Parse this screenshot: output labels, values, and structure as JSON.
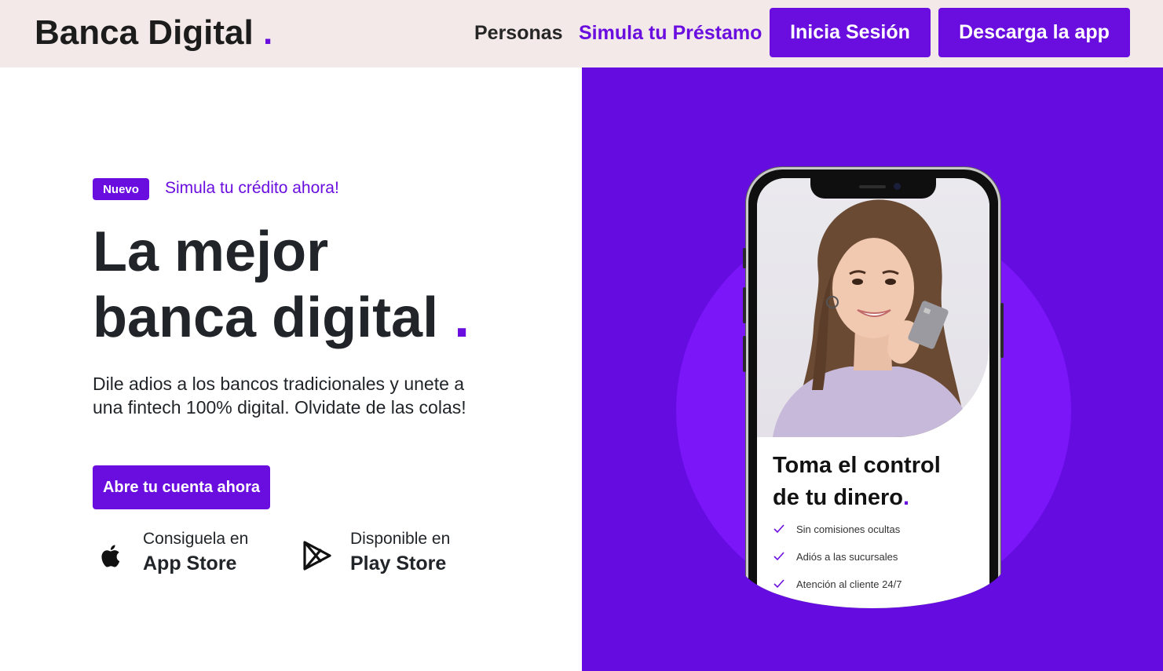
{
  "navbar": {
    "brand": "Banca Digital",
    "brand_dot": ".",
    "links": {
      "personas": "Personas",
      "simula": "Simula tu Préstamo"
    },
    "login_button": "Inicia Sesión",
    "download_button": "Descarga la app"
  },
  "hero": {
    "badge": "Nuevo",
    "badge_link": "Simula tu crédito ahora!",
    "title_line1": "La mejor",
    "title_line2": "banca digital",
    "title_dot": ".",
    "description": "Dile adios a los bancos tradicionales y unete a una fintech 100% digital. Olvidate de las colas!",
    "cta": "Abre tu cuenta ahora"
  },
  "stores": {
    "apple": {
      "small": "Consiguela en",
      "big": "App Store",
      "icon": "apple-icon"
    },
    "google": {
      "small": "Disponible en",
      "big": "Play Store",
      "icon": "google-play-icon"
    }
  },
  "phone": {
    "headline_line1": "Toma el control",
    "headline_line2": "de tu dinero",
    "headline_dot": ".",
    "features": [
      "Sin comisiones ocultas",
      "Adiós a las sucursales",
      "Atención al cliente 24/7"
    ]
  },
  "colors": {
    "accent": "#6a0ee0",
    "panel": "#650ce0",
    "circle": "#7a16f8",
    "navbar_bg": "#f2e9e8"
  }
}
